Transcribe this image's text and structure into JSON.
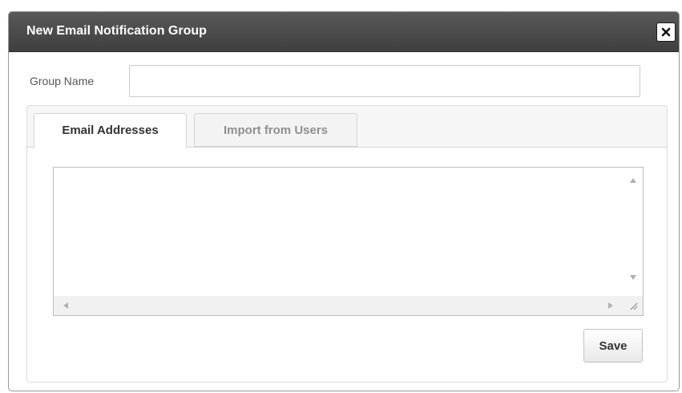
{
  "dialog": {
    "title": "New Email Notification Group",
    "close_icon": "close-x-icon"
  },
  "form": {
    "group_name_label": "Group Name",
    "group_name_value": "",
    "group_name_placeholder": ""
  },
  "tabs": [
    {
      "label": "Email Addresses",
      "active": true
    },
    {
      "label": "Import from Users",
      "active": false
    }
  ],
  "email_addresses": {
    "value": ""
  },
  "actions": {
    "save_label": "Save"
  },
  "colors": {
    "titlebar": "#4a4a4a",
    "title_text": "#ffffff",
    "inactive_tab_text": "#8f8f8f"
  }
}
